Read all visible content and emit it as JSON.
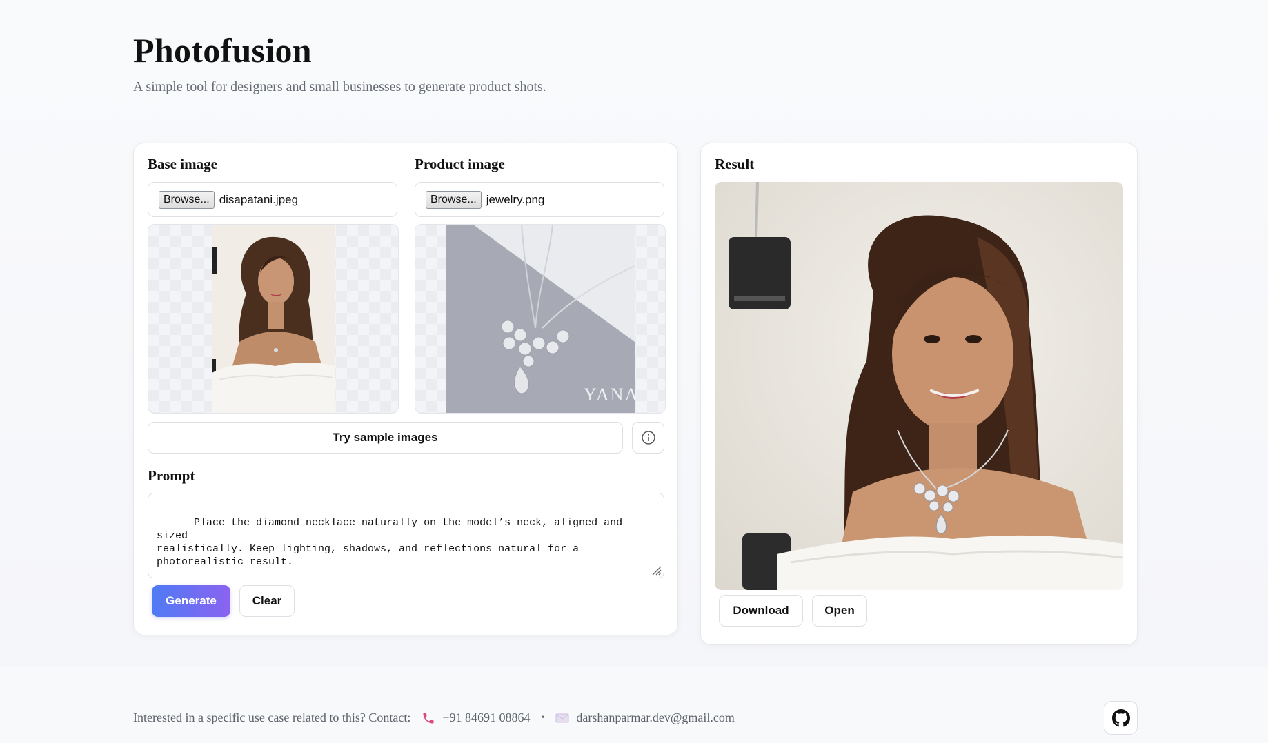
{
  "header": {
    "title": "Photofusion",
    "subtitle": "A simple tool for designers and small businesses to generate product shots."
  },
  "inputs": {
    "base": {
      "label": "Base image",
      "browse_label": "Browse...",
      "filename": "disapatani.jpeg"
    },
    "product": {
      "label": "Product image",
      "browse_label": "Browse...",
      "filename": "jewelry.png",
      "watermark": "YANA"
    },
    "sample_button": "Try sample images",
    "info_icon": "info-icon"
  },
  "prompt": {
    "label": "Prompt",
    "value": "Place the diamond necklace naturally on the model’s neck, aligned and sized\nrealistically. Keep lighting, shadows, and reflections natural for a\nphotorealistic result."
  },
  "actions": {
    "generate": "Generate",
    "clear": "Clear"
  },
  "result": {
    "label": "Result",
    "download": "Download",
    "open": "Open"
  },
  "footer": {
    "contact_text": "Interested in a specific use case related to this? Contact:",
    "phone": "+91 84691 08864",
    "separator": "•",
    "email": "darshanparmar.dev@gmail.com",
    "phone_icon": "phone-icon",
    "email_icon": "envelope-icon",
    "github_icon": "github-icon"
  },
  "colors": {
    "accent_start": "#4f7bf4",
    "accent_end": "#8b63f0",
    "phone_icon": "#e0457b"
  }
}
